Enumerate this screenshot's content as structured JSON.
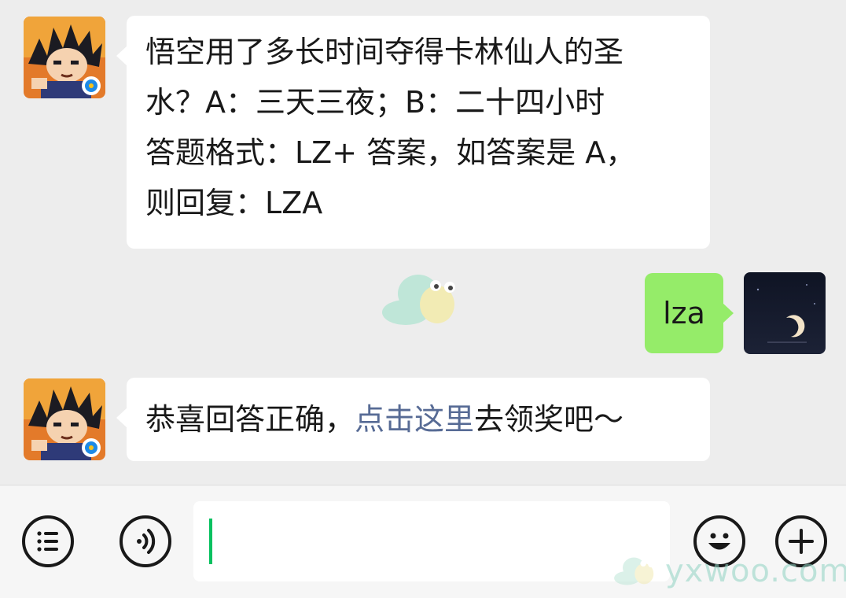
{
  "chat": {
    "messages": [
      {
        "from": "contact",
        "lines": [
          "悟空用了多长时间夺得卡林仙人的圣",
          "水？A：三天三夜；B：二十四小时",
          "答题格式：LZ+ 答案，如答案是 A，",
          "则回复：LZA"
        ]
      },
      {
        "from": "me",
        "text": "lza"
      },
      {
        "from": "contact",
        "text_before": "恭喜回答正确，",
        "link_text": "点击这里",
        "text_after": "去领奖吧～"
      }
    ]
  },
  "input_bar": {
    "input_value": "",
    "icons": {
      "menu": "list-menu-icon",
      "voice": "voice-icon",
      "emoji": "smiley-icon",
      "more": "plus-icon"
    }
  },
  "watermark": {
    "text": "yxwoo.com"
  },
  "colors": {
    "background": "#ededed",
    "incoming_bubble": "#ffffff",
    "outgoing_bubble": "#95ec69",
    "link": "#576b95",
    "caret": "#07c160"
  }
}
